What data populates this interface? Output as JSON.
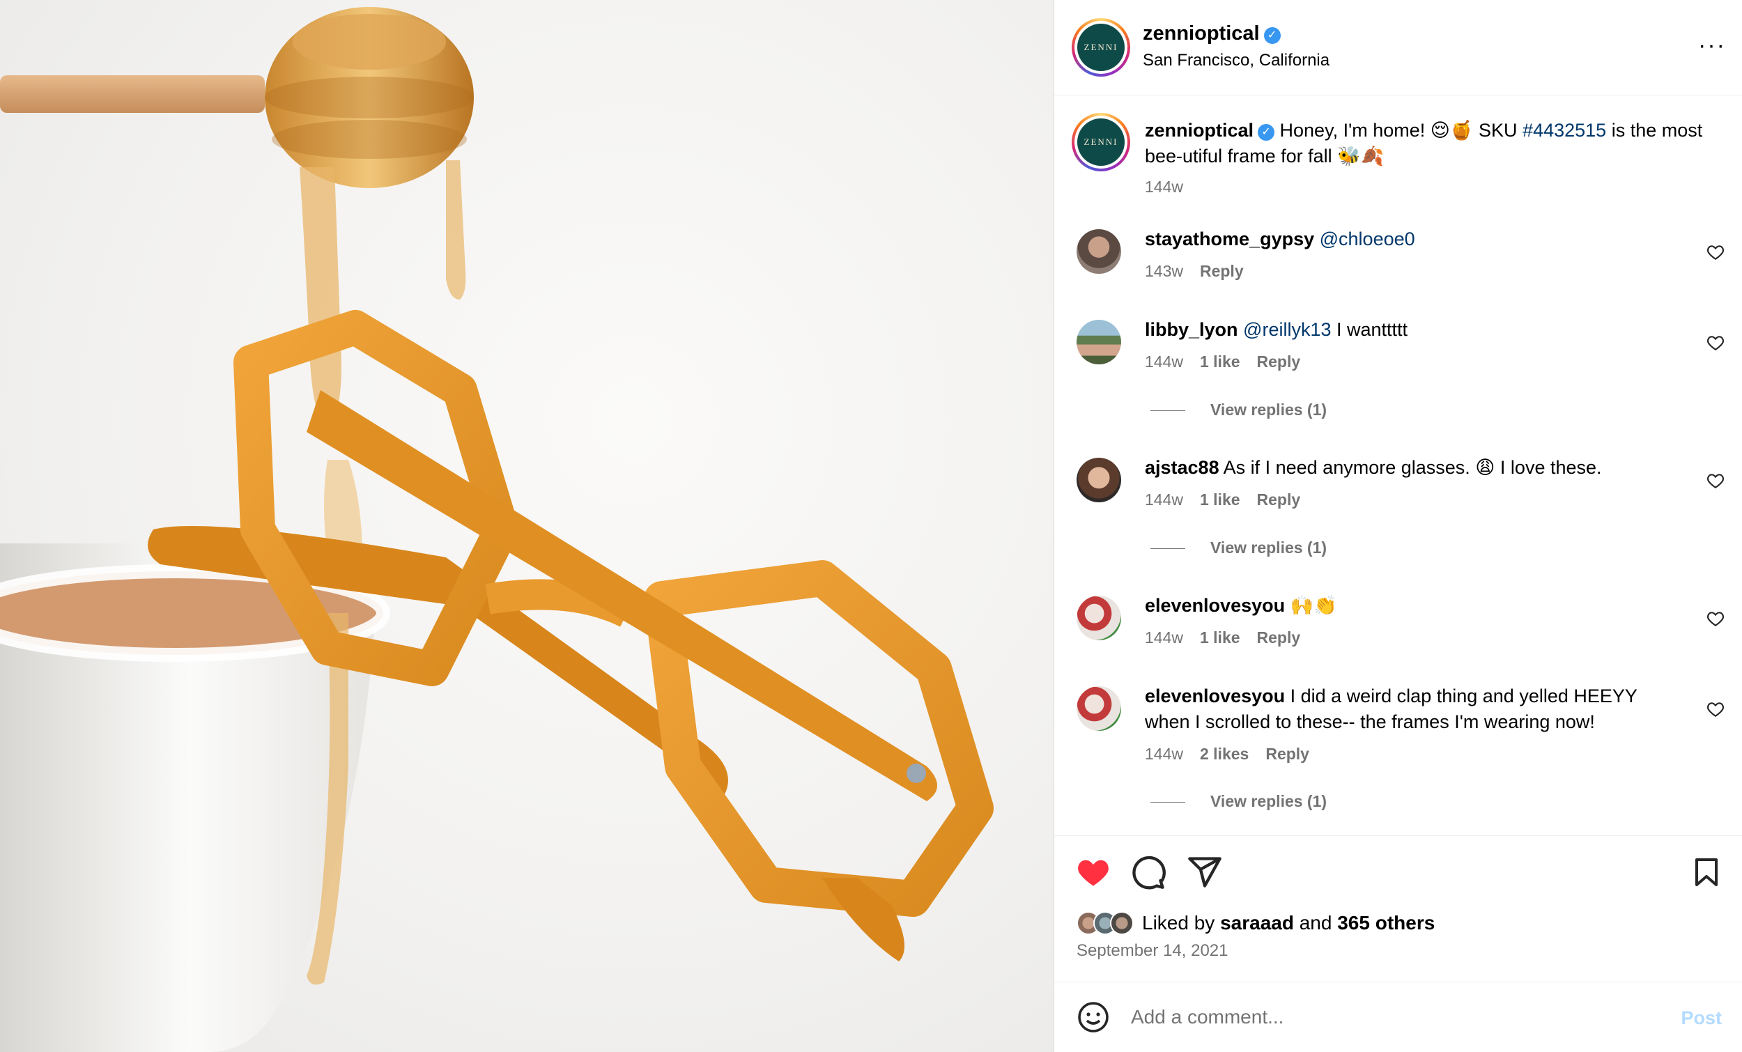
{
  "post": {
    "username": "zennioptical",
    "location": "San Francisco, California",
    "avatar_text": "ZENNI",
    "verified_icon": "checkmark-icon",
    "more_icon": "···"
  },
  "caption": {
    "username": "zennioptical",
    "text_before_link": "Honey, I'm home! 😌🍯 SKU ",
    "hashtag": "#4432515",
    "text_after_link": " is the most bee-utiful frame for fall 🐝🍂",
    "time": "144w"
  },
  "comments": [
    {
      "username": "stayathome_gypsy",
      "mention": "@chloeoe0",
      "text": "",
      "time": "143w",
      "likes": "",
      "reply": "Reply",
      "view_replies": ""
    },
    {
      "username": "libby_lyon",
      "mention": "@reillyk13",
      "text": " I wanttttt",
      "time": "144w",
      "likes": "1 like",
      "reply": "Reply",
      "view_replies": "View replies (1)"
    },
    {
      "username": "ajstac88",
      "mention": "",
      "text": " As if I need anymore glasses. 😩 I love these.",
      "time": "144w",
      "likes": "1 like",
      "reply": "Reply",
      "view_replies": "View replies (1)"
    },
    {
      "username": "elevenlovesyou",
      "mention": "",
      "text": " 🙌👏",
      "time": "144w",
      "likes": "1 like",
      "reply": "Reply",
      "view_replies": ""
    },
    {
      "username": "elevenlovesyou",
      "mention": "",
      "text": " I did a weird clap thing and yelled HEEYY when I scrolled to these-- the frames I'm wearing now!",
      "time": "144w",
      "likes": "2 likes",
      "reply": "Reply",
      "view_replies": "View replies (1)"
    }
  ],
  "actions": {
    "liked_prefix": "Liked by ",
    "liked_user": "saraaad",
    "liked_and": " and ",
    "liked_others": "365 others",
    "date": "September 14, 2021",
    "like_color": "#ff3040"
  },
  "add_comment": {
    "placeholder": "Add a comment...",
    "post_label": "Post"
  }
}
